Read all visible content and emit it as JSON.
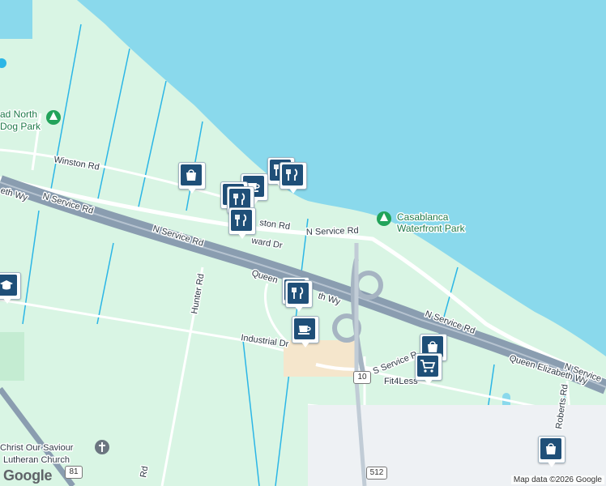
{
  "colors": {
    "water": "#8ad9ec",
    "land": "#d9f5e4",
    "road": "#ffffff",
    "highway": "#8a9db0",
    "stream": "#2bb6e6",
    "marker": "#1f4f78",
    "park_icon": "#22a35a"
  },
  "labels": {
    "winston_rd": "Winston Rd",
    "winston_rd_2": "ston Rd",
    "n_service_rd_1": "N Service Rd",
    "n_service_rd_2": "N Service Rd",
    "n_service_rd_3": "N Service Rd",
    "n_service_rd_4": "N Service Rd",
    "n_service_rd_5": "N Service",
    "qew_1": "Queen",
    "qew_2": "th Wy",
    "qew_3": "Queen Elizabeth Wy",
    "qew_4": "eth Wy",
    "s_service_rd": "S Service R",
    "industrial_dr": "Industrial Dr",
    "hunter_rd": "Hunter Rd",
    "roberts_rd": "Roberts Rd",
    "ward_dr": "ward Dr",
    "rd_bottom": "Rd",
    "dog_park": "ad North\nDog Park",
    "dog_park_1": "ad North",
    "dog_park_2": "Dog Park",
    "casablanca_1": "Casablanca",
    "casablanca_2": "Waterfront Park",
    "church_1": "Christ Our Saviour",
    "church_2": "Lutheran Church",
    "fit4less": "Fit4Less"
  },
  "shields": {
    "hwy_10": "10",
    "hwy_81": "81",
    "hwy_512": "512"
  },
  "markers": [
    {
      "name": "shopping-bag-marker",
      "icon": "shopping-bag-icon"
    },
    {
      "name": "restaurant-marker-1",
      "icon": "fork-knife-icon"
    },
    {
      "name": "restaurant-marker-2",
      "icon": "fork-knife-icon"
    },
    {
      "name": "cafe-marker-1",
      "icon": "coffee-cup-icon"
    },
    {
      "name": "restaurant-marker-3",
      "icon": "fork-knife-icon"
    },
    {
      "name": "restaurant-marker-4",
      "icon": "fork-knife-icon"
    },
    {
      "name": "restaurant-marker-5",
      "icon": "fork-knife-icon"
    },
    {
      "name": "school-marker",
      "icon": "graduation-cap-icon"
    },
    {
      "name": "restaurant-marker-6",
      "icon": "fork-knife-icon"
    },
    {
      "name": "cafe-marker-2",
      "icon": "coffee-cup-icon"
    },
    {
      "name": "shopping-bag-marker-2",
      "icon": "shopping-bag-icon"
    },
    {
      "name": "grocery-marker",
      "icon": "shopping-cart-icon"
    },
    {
      "name": "shopping-bag-marker-3",
      "icon": "shopping-bag-icon"
    }
  ],
  "attribution": "Map data ©2026 Google",
  "logo": "Google"
}
